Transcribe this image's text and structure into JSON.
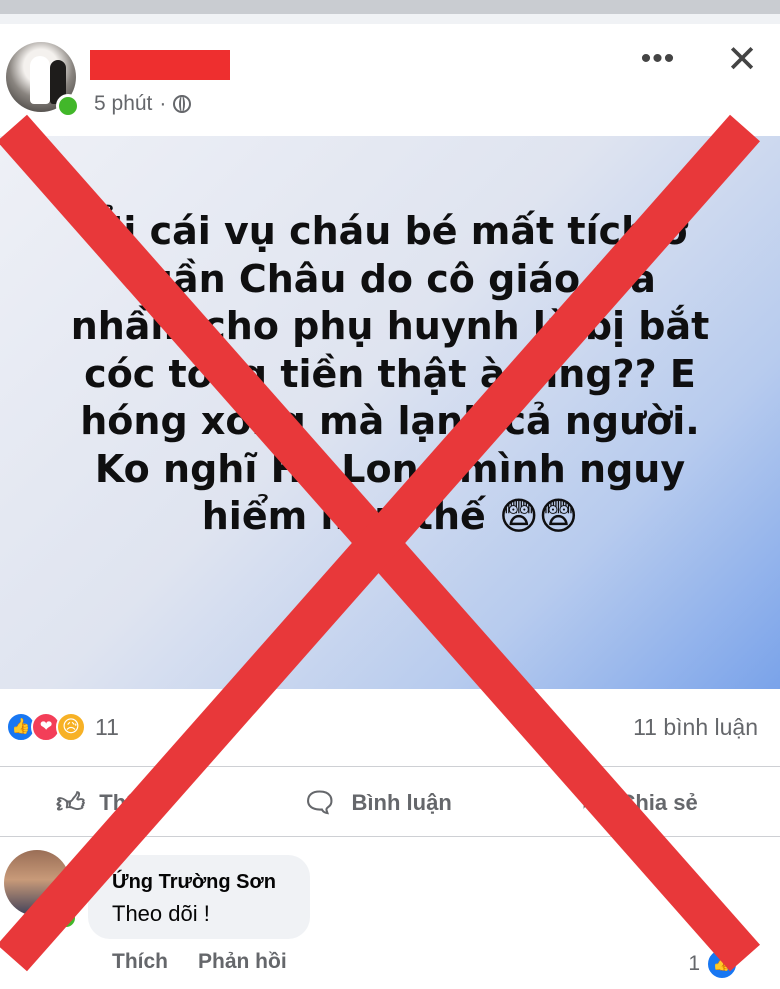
{
  "header": {
    "time": "5 phút",
    "separator": "·",
    "more_label": "•••",
    "close_label": "✕"
  },
  "post": {
    "text": "Ủi cái vụ cháu bé mất tích ở\nTuần Châu do cô giáo trả\nnhầm cho phụ huynh là bị bắt\ncóc tống tiền thật à mng?? E\nhóng xong mà lạnh cả người.\nKo nghĩ Hạ Long mình nguy\nhiểm như thế 😨😨"
  },
  "reactions": {
    "icons": [
      "like-icon",
      "love-icon",
      "sad-icon"
    ],
    "count": "11",
    "comments": "11 bình luận"
  },
  "actions": {
    "like": "Thích",
    "comment": "Bình luận",
    "share": "Chia sẻ"
  },
  "comment": {
    "author": "Ứng Trường Sơn",
    "text": "Theo dõi !",
    "like_action": "Thích",
    "reply_action": "Phản hồi",
    "like_count": "1"
  },
  "colors": {
    "overlay_red": "#e8383a",
    "accent_blue": "#1877f2",
    "online_green": "#42b72a"
  }
}
